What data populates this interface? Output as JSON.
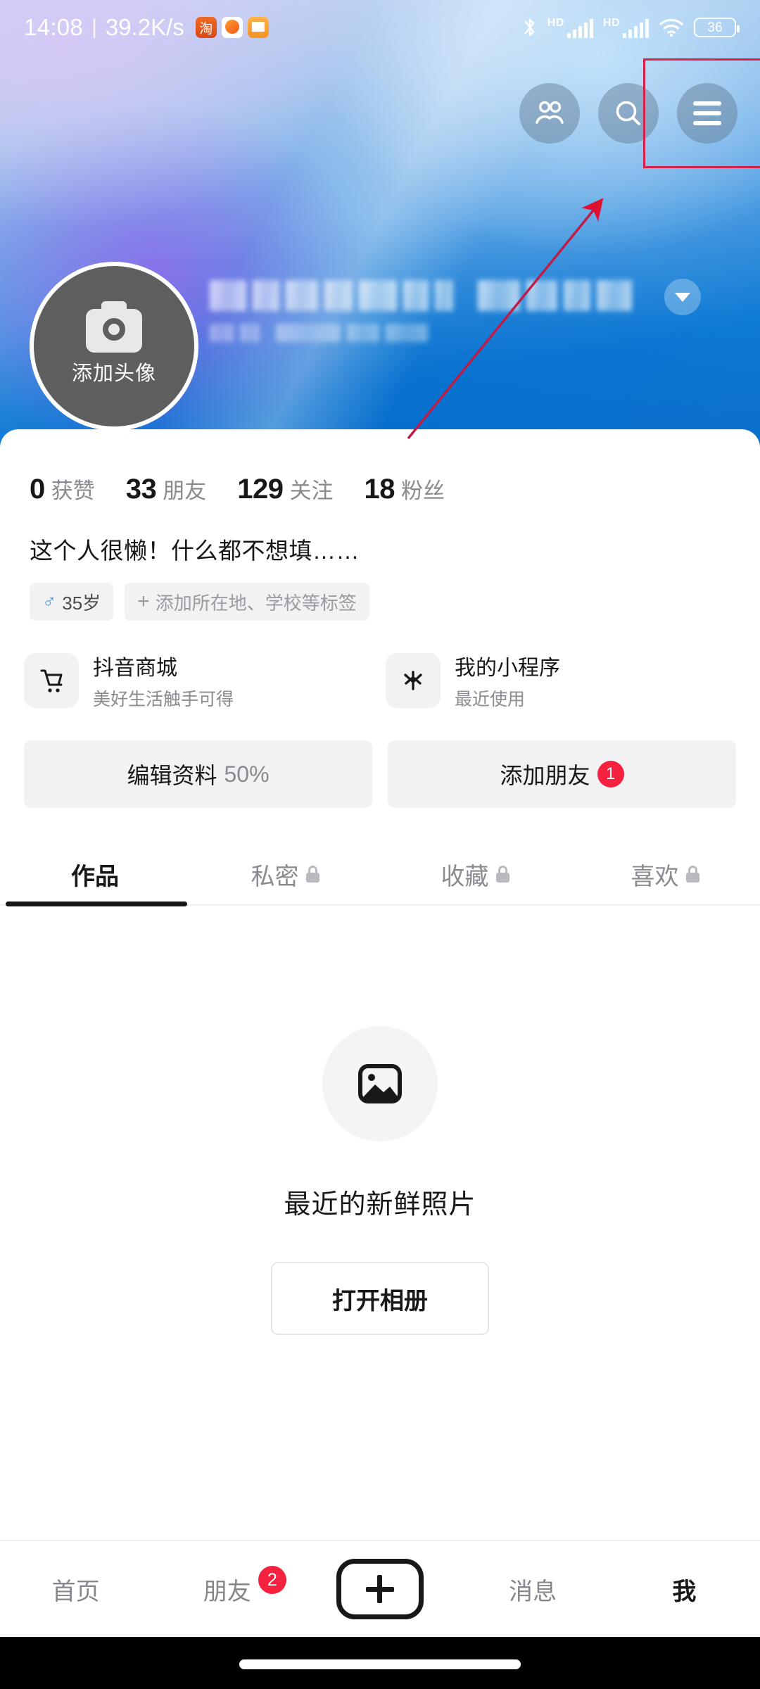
{
  "status_bar": {
    "time": "14:08",
    "separator": "|",
    "network_speed": "39.2K/s",
    "app_icons": [
      "taobao-icon",
      "orange-app-icon",
      "message-app-icon"
    ],
    "bluetooth": "bluetooth-icon",
    "sim1_label": "HD",
    "sim2_label": "HD",
    "wifi": "wifi-icon",
    "battery_level": "36"
  },
  "header": {
    "actions": [
      {
        "name": "friends-icon",
        "label": ""
      },
      {
        "name": "search-icon",
        "label": ""
      },
      {
        "name": "hamburger-menu-icon",
        "label": "",
        "highlighted": true
      }
    ],
    "highlight_color": "#d6214b",
    "avatar": {
      "label": "添加头像",
      "icon": "camera-icon"
    },
    "name_redacted": true,
    "expand_icon": "chevron-down-icon"
  },
  "stats": [
    {
      "value": "0",
      "label": "获赞"
    },
    {
      "value": "33",
      "label": "朋友"
    },
    {
      "value": "129",
      "label": "关注"
    },
    {
      "value": "18",
      "label": "粉丝"
    }
  ],
  "bio": "这个人很懒！什么都不想填……",
  "tags": [
    {
      "icon": "male-gender-icon",
      "text": "35岁"
    },
    {
      "icon": "plus-icon",
      "text": "添加所在地、学校等标签"
    }
  ],
  "services": [
    {
      "icon": "shopping-cart-icon",
      "title": "抖音商城",
      "subtitle": "美好生活触手可得"
    },
    {
      "icon": "mini-program-icon",
      "title": "我的小程序",
      "subtitle": "最近使用"
    }
  ],
  "actions": {
    "edit_profile": {
      "label": "编辑资料",
      "percent": "50%"
    },
    "add_friend": {
      "label": "添加朋友",
      "badge": "1"
    }
  },
  "tabs": [
    {
      "label": "作品",
      "locked": false,
      "active": true
    },
    {
      "label": "私密",
      "locked": true,
      "active": false
    },
    {
      "label": "收藏",
      "locked": true,
      "active": false
    },
    {
      "label": "喜欢",
      "locked": true,
      "active": false
    }
  ],
  "empty_state": {
    "icon": "photo-placeholder-icon",
    "title": "最近的新鲜照片",
    "button_label": "打开相册"
  },
  "bottom_nav": [
    {
      "label": "首页",
      "active": false,
      "badge": ""
    },
    {
      "label": "朋友",
      "active": false,
      "badge": "2"
    },
    {
      "label": "",
      "active": false,
      "badge": "",
      "icon": "plus-create-icon"
    },
    {
      "label": "消息",
      "active": false,
      "badge": ""
    },
    {
      "label": "我",
      "active": true,
      "badge": ""
    }
  ],
  "colors": {
    "accent_red": "#f5213f",
    "annotation_red": "#d6214b",
    "text_primary": "#17181a",
    "text_secondary": "#8a8b91",
    "chip_bg": "#f2f2f4"
  }
}
